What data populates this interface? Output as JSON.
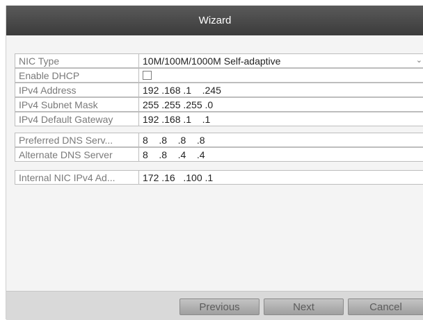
{
  "dialog": {
    "title": "Wizard"
  },
  "fields": {
    "nic_type": {
      "label": "NIC Type",
      "value": "10M/100M/1000M Self-adaptive"
    },
    "enable_dhcp": {
      "label": "Enable DHCP",
      "checked": false
    },
    "ipv4_address": {
      "label": "IPv4 Address",
      "value": "192 .168 .1    .245"
    },
    "ipv4_subnet_mask": {
      "label": "IPv4 Subnet Mask",
      "value": "255 .255 .255 .0"
    },
    "ipv4_default_gateway": {
      "label": "IPv4 Default Gateway",
      "value": "192 .168 .1    .1"
    },
    "preferred_dns": {
      "label": "Preferred DNS Serv...",
      "value": "8    .8    .8    .8"
    },
    "alternate_dns": {
      "label": "Alternate DNS Server",
      "value": "8    .8    .4    .4"
    },
    "internal_nic": {
      "label": "Internal NIC IPv4 Ad...",
      "value": "172 .16   .100 .1"
    }
  },
  "buttons": {
    "previous": "Previous",
    "next": "Next",
    "cancel": "Cancel"
  },
  "colors": {
    "titlebar": "#4a4a4a",
    "label_text": "#7a7a7a",
    "footer": "#d9d9d9"
  }
}
